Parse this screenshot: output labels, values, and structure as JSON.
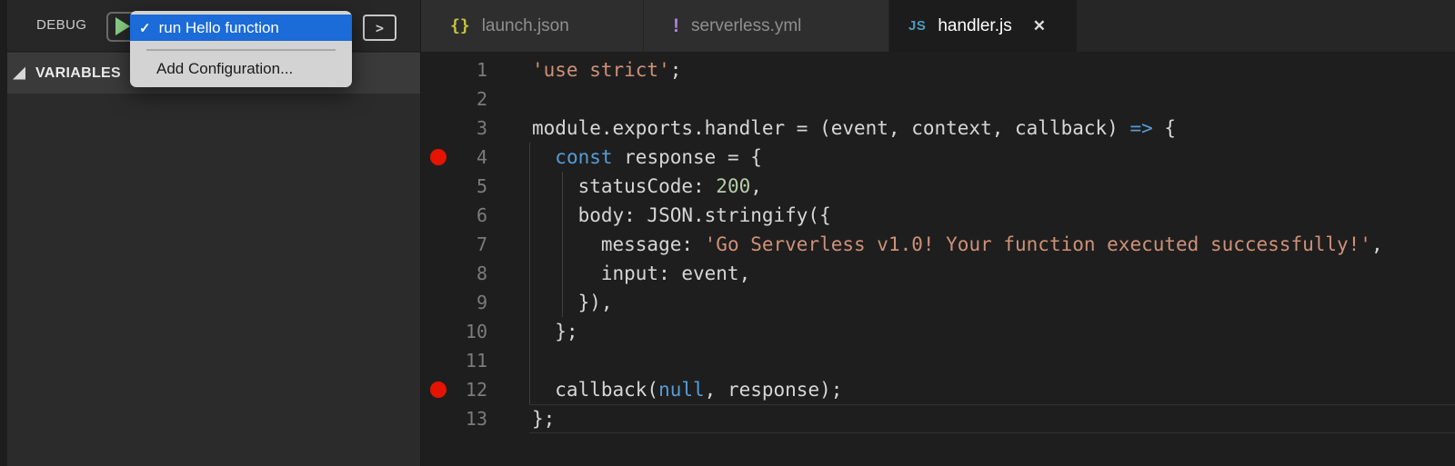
{
  "toolbar": {
    "debug_label": "DEBUG",
    "console_icon_glyph": ">"
  },
  "menu": {
    "selected": {
      "check": "✓",
      "label": "run Hello function"
    },
    "add_config": {
      "label": "Add Configuration..."
    }
  },
  "sidebar": {
    "sections": [
      {
        "label": "VARIABLES"
      }
    ]
  },
  "tabs": [
    {
      "label": "launch.json",
      "icon_glyph": "{}",
      "icon_name": "json-braces-icon",
      "icon_class": "braces",
      "icon_color": "#c5c541",
      "active": false
    },
    {
      "label": "serverless.yml",
      "icon_glyph": "!",
      "icon_name": "yaml-warning-icon",
      "icon_class": "warn",
      "icon_color": "#b180d7",
      "active": false
    },
    {
      "label": "handler.js",
      "icon_glyph": "JS",
      "icon_name": "javascript-icon",
      "icon_class": "js",
      "icon_color": "#519aba",
      "active": true,
      "close_glyph": "✕"
    }
  ],
  "editor": {
    "breakpoint_lines": [
      4,
      12
    ],
    "current_line": 13,
    "lines": [
      {
        "num": 1,
        "tokens": [
          {
            "type": "str",
            "text": "'use strict'"
          },
          {
            "type": "p",
            "text": ";"
          }
        ]
      },
      {
        "num": 2,
        "tokens": []
      },
      {
        "num": 3,
        "tokens": [
          {
            "type": "p",
            "text": "module.exports.handler = (event, context, callback) "
          },
          {
            "type": "kw",
            "text": "=>"
          },
          {
            "type": "p",
            "text": " {"
          }
        ]
      },
      {
        "num": 4,
        "breakpoint": true,
        "tokens": [
          {
            "type": "p",
            "text": "  "
          },
          {
            "type": "kw",
            "text": "const"
          },
          {
            "type": "p",
            "text": " response = {"
          }
        ]
      },
      {
        "num": 5,
        "tokens": [
          {
            "type": "p",
            "text": "    statusCode: "
          },
          {
            "type": "num",
            "text": "200"
          },
          {
            "type": "p",
            "text": ","
          }
        ]
      },
      {
        "num": 6,
        "tokens": [
          {
            "type": "p",
            "text": "    body: JSON.stringify({"
          }
        ]
      },
      {
        "num": 7,
        "tokens": [
          {
            "type": "p",
            "text": "      message: "
          },
          {
            "type": "str",
            "text": "'Go Serverless v1.0! Your function executed successfully!'"
          },
          {
            "type": "p",
            "text": ","
          }
        ]
      },
      {
        "num": 8,
        "tokens": [
          {
            "type": "p",
            "text": "      input: event,"
          }
        ]
      },
      {
        "num": 9,
        "tokens": [
          {
            "type": "p",
            "text": "    }),"
          }
        ]
      },
      {
        "num": 10,
        "tokens": [
          {
            "type": "p",
            "text": "  };"
          }
        ]
      },
      {
        "num": 11,
        "tokens": []
      },
      {
        "num": 12,
        "breakpoint": true,
        "tokens": [
          {
            "type": "p",
            "text": "  callback("
          },
          {
            "type": "kw",
            "text": "null"
          },
          {
            "type": "p",
            "text": ", response);"
          }
        ]
      },
      {
        "num": 13,
        "current": true,
        "tokens": [
          {
            "type": "p",
            "text": "};"
          }
        ]
      }
    ]
  },
  "colors": {
    "editor_bg": "#1e1e1e",
    "sidebar_bg": "#2b2b2b",
    "section_header_bg": "#3a3a3a",
    "tab_inactive_bg": "#2e2e2e",
    "tab_active_bg": "#1c1c1c",
    "tab_strip_bg": "#262626",
    "keyword": "#569cd6",
    "string": "#ce9178",
    "number": "#b5cea8",
    "breakpoint_red": "#e51400",
    "play_green": "#89d185",
    "menu_highlight_blue": "#1b6bd8",
    "line_number": "#7c7c7c",
    "code_text": "#d6d6d6"
  }
}
